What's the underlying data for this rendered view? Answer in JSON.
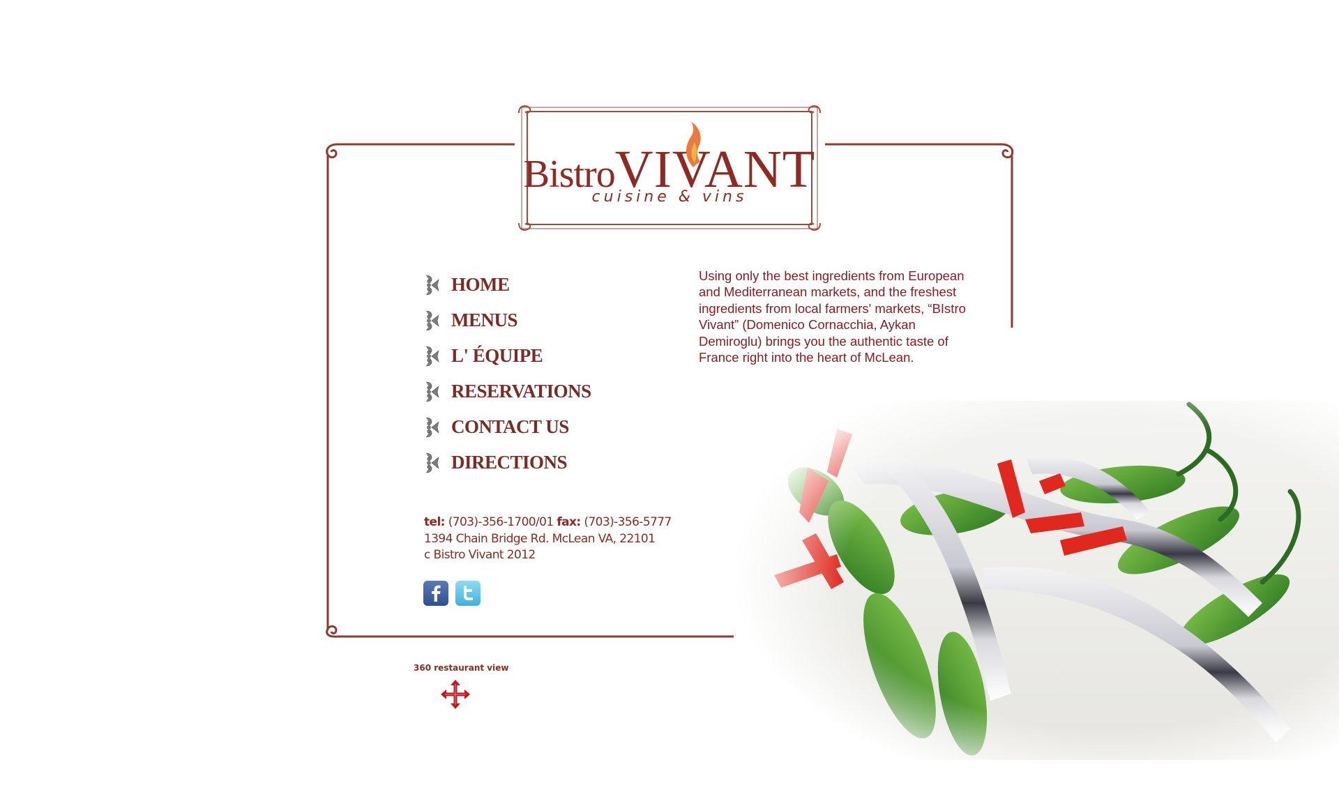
{
  "brand": {
    "name_part1": "Bistro",
    "name_part2": "VIVANT",
    "tagline": "cuisine & vins"
  },
  "nav": {
    "items": [
      {
        "label": "HOME"
      },
      {
        "label": "MENUS"
      },
      {
        "label": "L' ÉQUIPE"
      },
      {
        "label": "RESERVATIONS"
      },
      {
        "label": "CONTACT US"
      },
      {
        "label": "DIRECTIONS"
      }
    ]
  },
  "intro": {
    "text": "Using only the best ingredients from European and Mediterranean markets, and the freshest ingredients from local farmers' markets, “BIstro Vivant” (Domenico Cornacchia, Aykan Demiroglu) brings you the authentic taste of France right into the heart of McLean."
  },
  "contact": {
    "tel_label": "tel:",
    "tel_value": "(703)-356-1700/01",
    "fax_label": "fax:",
    "fax_value": "(703)-356-5777",
    "address": "1394 Chain Bridge Rd. McLean VA, 22101",
    "copyright": "c  Bistro Vivant 2012"
  },
  "social": {
    "facebook_icon": "facebook-icon",
    "twitter_icon": "twitter-icon"
  },
  "view360": {
    "label": "360 restaurant view",
    "icon": "move-arrows-icon"
  },
  "colors": {
    "brand": "#8f2a22",
    "text": "#8b1a1f",
    "flame": "#e86a2a",
    "arrows": "#c4161c"
  }
}
